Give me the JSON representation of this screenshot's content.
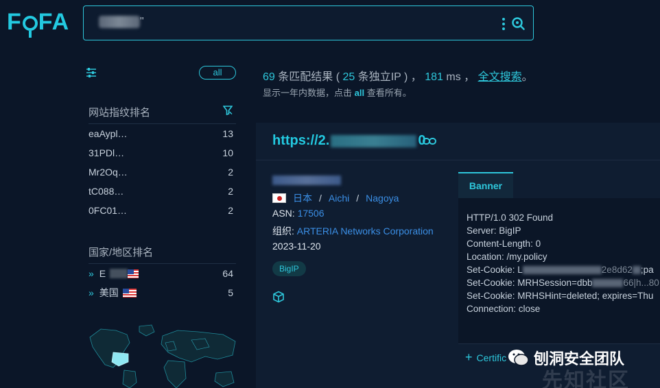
{
  "header": {
    "logo": "FOFA",
    "search_value": "\"",
    "search_icon": "search-icon",
    "menu_icon": "kebab-menu-icon"
  },
  "sidebar": {
    "all_label": "all",
    "fingerprint_title": "网站指纹排名",
    "fingerprints": [
      {
        "name": "eaAypl…",
        "count": "13"
      },
      {
        "name": "31PDl…",
        "count": "10"
      },
      {
        "name": "Mr2Oq…",
        "count": "2"
      },
      {
        "name": "tC088…",
        "count": "2"
      },
      {
        "name": "0FC01…",
        "count": "2"
      }
    ],
    "country_title": "国家/地区排名",
    "countries": [
      {
        "name": "E",
        "count": "64"
      },
      {
        "name": "美国",
        "count": "5"
      }
    ]
  },
  "summary": {
    "count": "69",
    "text1": " 条匹配结果 ( ",
    "ip_count": "25",
    "text2": " 条独立IP ) ， ",
    "ms": "181",
    "text3": " ms ， ",
    "fulltext": "全文搜索",
    "end": "。",
    "sub_prefix": "显示一年内数据，点击 ",
    "sub_all": "all",
    "sub_suffix": " 查看所有。"
  },
  "result": {
    "url_prefix": "https://2.",
    "url_suffix": "0",
    "country": "日本",
    "region": "Aichi",
    "city": "Nagoya",
    "asn_label": "ASN: ",
    "asn": "17506",
    "org_label": "组织: ",
    "org": "ARTERIA Networks Corporation",
    "date": "2023-11-20",
    "tag": "BigIP",
    "banner_tab": "Banner",
    "banner_lines": [
      "HTTP/1.0 302 Found",
      "Server: BigIP",
      "Content-Length: 0",
      "Location: /my.policy",
      "Set-Cookie: L",
      "Set-Cookie: MRHSession=dbb",
      "Set-Cookie: MRHSHint=deleted; expires=Thu",
      "Connection: close"
    ],
    "cookie1_tail": "2e8d62",
    "cookie1_end": ";pa",
    "cookie2_tail": "66|h...80",
    "cert_label": "Certific"
  },
  "watermark": {
    "text": "刨洞安全团队",
    "text2": "先知社区"
  },
  "colors": {
    "background": "#0b1628",
    "accent": "#2ec8dc",
    "link": "#3b8fe6"
  }
}
